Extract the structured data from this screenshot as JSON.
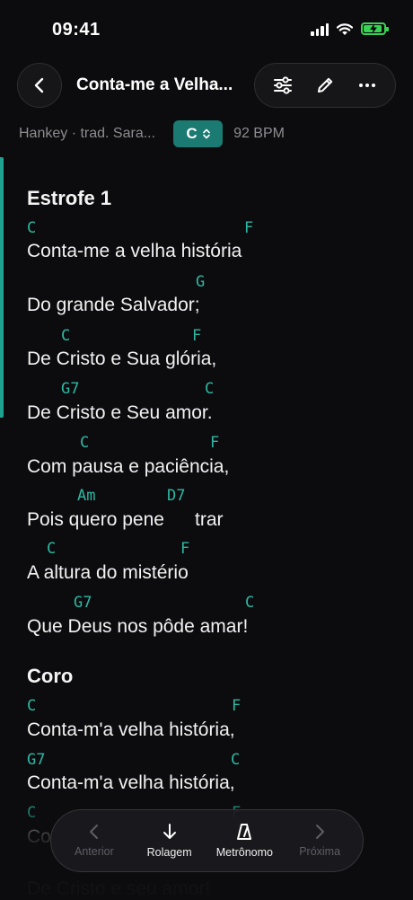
{
  "status": {
    "time": "09:41"
  },
  "header": {
    "title": "Conta-me a Velha...",
    "author": "Hankey · trad. Sara...",
    "key": "C",
    "bpm": "92 BPM"
  },
  "song": {
    "section1": {
      "title": "Estrofe 1"
    },
    "section2": {
      "title": "Coro"
    },
    "chords": [
      "C",
      "F",
      "G",
      "C",
      "F",
      "G7",
      "C",
      "C",
      "F",
      "Am",
      "D7",
      "C",
      "F",
      "G7",
      "C",
      "C",
      "F",
      "G7",
      "C",
      "C",
      "F"
    ],
    "lyrics": [
      "Conta-me a velha história",
      "Do grande Salvador;",
      "De Cristo e Sua glória,",
      "De Cristo e Seu amor.",
      "Com pausa e paciência,",
      "Pois quero pene",
      "trar",
      "A altura do mistério",
      "Que Deus nos pôde amar!",
      "Conta-m'a velha história,",
      "Conta-m'a velha história,",
      "Co",
      "De Cristo e seu amor!"
    ]
  },
  "toolbar": {
    "previous": "Anterior",
    "scroll": "Rolagem",
    "metronome": "Metrônomo",
    "next": "Próxima"
  },
  "colors": {
    "accent": "#1b7a72",
    "chord": "#2fb7a3",
    "battery": "#39d353"
  },
  "icons": [
    "back-chevron-icon",
    "sliders-icon",
    "pencil-icon",
    "more-icon",
    "chevron-left-icon",
    "arrow-down-icon",
    "metronome-icon",
    "chevron-right-icon"
  ]
}
